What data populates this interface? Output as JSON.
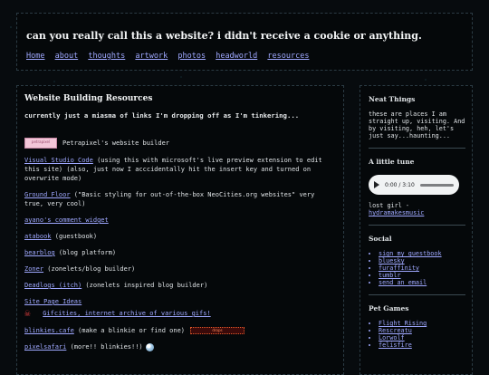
{
  "header": {
    "title": "can you really call this a website? i didn't receive a cookie or anything.",
    "nav": [
      "Home",
      "about",
      "thoughts",
      "artwork",
      "photos",
      "headworld",
      "resources"
    ]
  },
  "main": {
    "heading": "Website Building Resources",
    "intro": "currently just a miasma of links I'm dropping off as I'm tinkering...",
    "petrapixel_badge": "petrapixel",
    "petrapixel_text": "Petrapixel's website builder",
    "vscode_link": "Visual Studio Code",
    "vscode_text": " (using this with microsoft's live preview extension to edit this site) (also, just now I acccidentally hit the insert key and turned on overwrite mode)",
    "groundfloor_link": "Ground Floor",
    "groundfloor_text": " (\"Basic styling for out-of-the-box NeoCities.org websites\" very true, very cool)",
    "ayano_link": "ayano's comment widget",
    "atabook_link": "atabook",
    "atabook_text": " (guestbook)",
    "bearblog_link": "bearblog",
    "bearblog_text": " (blog platform)",
    "zoner_link": "Zoner",
    "zoner_text": " (zonelets/blog builder)",
    "deadlogs_link": "Deadlogs (itch)",
    "deadlogs_text": " (zonelets inspired blog builder)",
    "sitepage_link": "Site Page Ideas",
    "gifcities_link": "Gifcities, internet archive of various gifs!",
    "blinkies_link": "blinkies.cafe",
    "blinkies_text": " (make a blinkie or find one)",
    "blinkie_label": "drops",
    "pixelsafari_link": "pixelsafari",
    "pixelsafari_text": " (more!! blinkies!!)"
  },
  "sidebar": {
    "neat_title": "Neat Things",
    "neat_text": "these are places I am straight up, visiting. And by visiting, heh, let's just say...haunting...",
    "tune_title": "A little tune",
    "player_time": "0:00 / 3:10",
    "song_text": "lost girl -",
    "song_link": "hydramakesmusic",
    "social_title": "Social",
    "social_links": [
      "sign my guestbook",
      "bluesky",
      "furaffinity",
      "tumblr",
      "send an email"
    ],
    "pet_title": "Pet Games",
    "pet_links": [
      "Flight Rising",
      "Rescreatu",
      "Lorwolf",
      "felisfire"
    ]
  }
}
